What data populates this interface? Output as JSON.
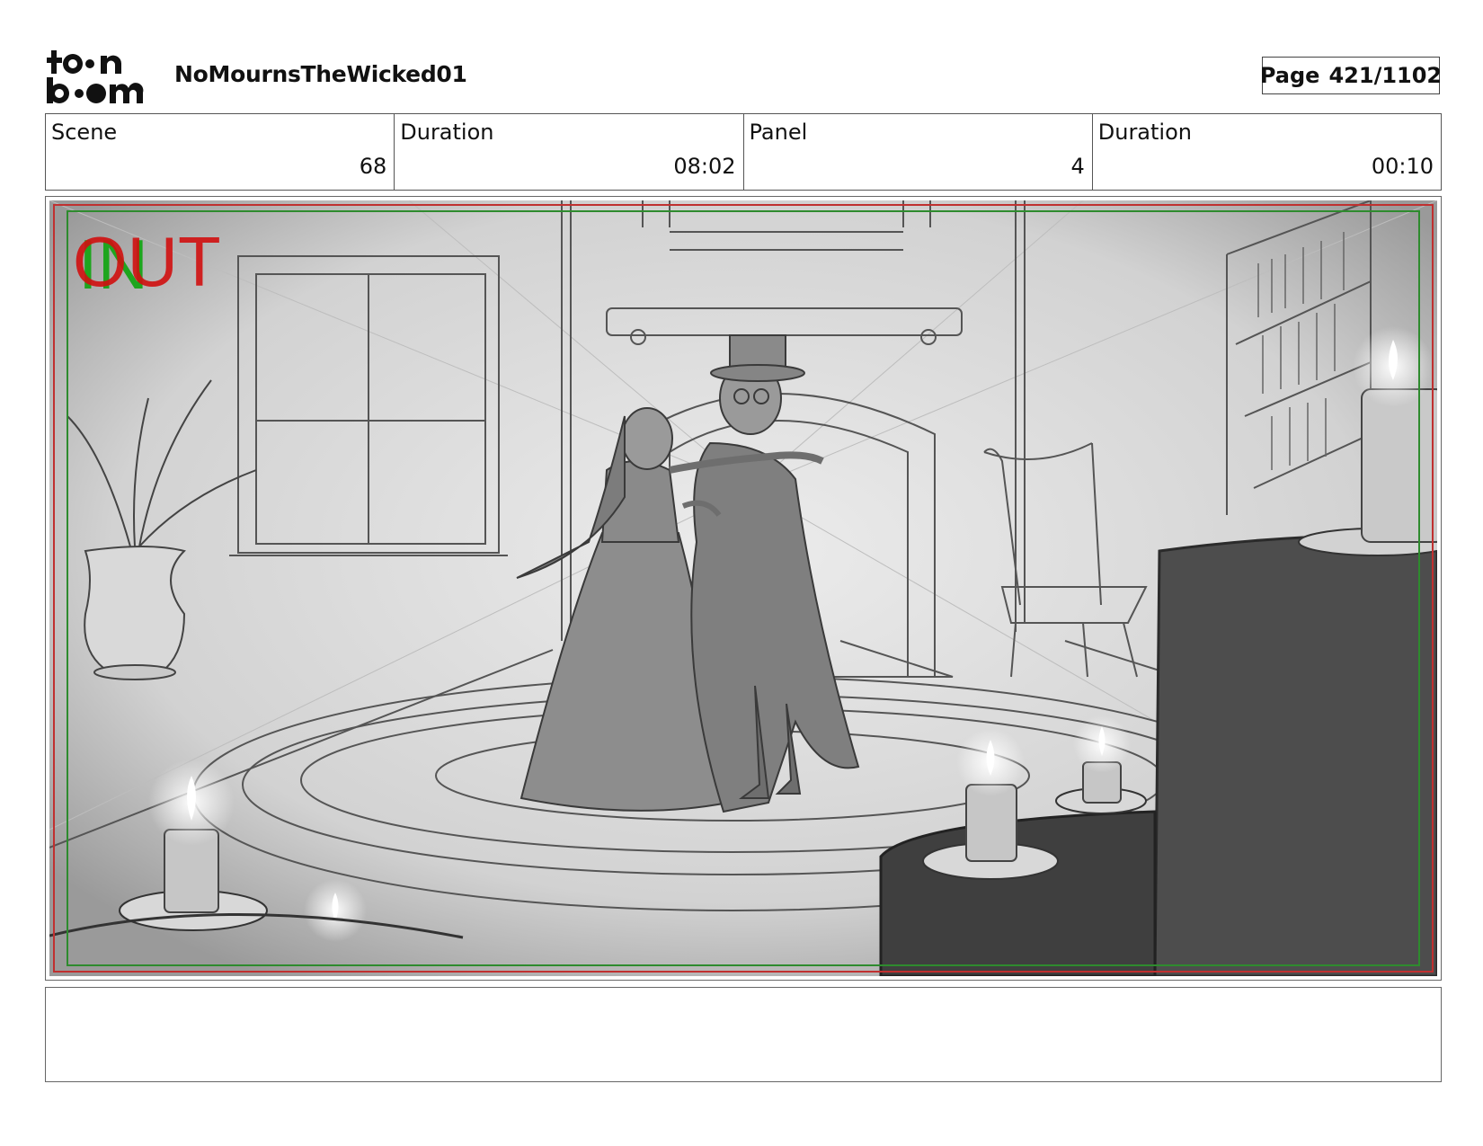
{
  "header": {
    "logo_text_top": "toon",
    "logo_text_bottom": "boom",
    "project_title": "NoMournsTheWicked01",
    "page_label": "Page",
    "page_number": "421/1102"
  },
  "info": {
    "scene_label": "Scene",
    "scene_value": "68",
    "scene_duration_label": "Duration",
    "scene_duration_value": "08:02",
    "panel_label": "Panel",
    "panel_value": "4",
    "panel_duration_label": "Duration",
    "panel_duration_value": "00:10"
  },
  "panel": {
    "overlay_in": "IN",
    "overlay_out": "OUT",
    "in_color": "#1ea51e",
    "out_color": "#d01010"
  },
  "notes": {
    "text": ""
  }
}
